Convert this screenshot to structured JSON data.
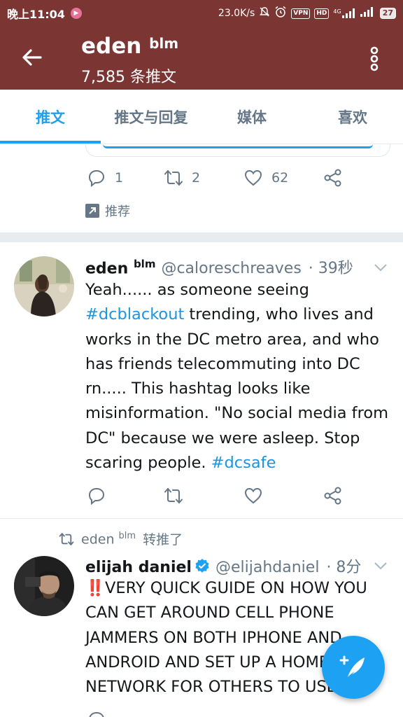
{
  "status_bar": {
    "time": "晚上11:04",
    "speed": "23.0K/s",
    "vpn": "VPN",
    "hd": "HD",
    "network": "4G",
    "battery": "27"
  },
  "header": {
    "title": "eden",
    "title_sup": "blm",
    "subtitle": "7,585 条推文"
  },
  "tabs": [
    {
      "label": "推文",
      "active": true
    },
    {
      "label": "推文与回复",
      "active": false
    },
    {
      "label": "媒体",
      "active": false
    },
    {
      "label": "喜欢",
      "active": false
    }
  ],
  "tweet0": {
    "reply_count": "1",
    "retweet_count": "2",
    "like_count": "62",
    "promoted_label": "推荐"
  },
  "tweet1": {
    "name": "eden",
    "name_sup": "blm",
    "handle": "@caloreschreaves",
    "time": "· 39秒",
    "text_part1": "Yeah...... as someone seeing ",
    "tag1": "#dcblackout",
    "text_part2": " trending, who lives and works in the DC metro area, and who has friends telecommuting into DC rn..... This hashtag looks like misinformation. \"No social media from DC\" because we were asleep. Stop scaring people. ",
    "tag2": "#dcsafe"
  },
  "tweet2": {
    "retweeter": "eden",
    "retweeter_sup": "blm",
    "retweet_label": "转推了",
    "name": "elijah daniel",
    "handle": "@elijahdaniel",
    "time": "· 8分",
    "text": "‼️VERY QUICK GUIDE ON HOW YOU CAN GET AROUND CELL PHONE JAMMERS ON BOTH IPHONE AND ANDROID AND SET UP A HOME NETWORK FOR OTHERS TO USE"
  },
  "colors": {
    "header_bg": "#7b3532",
    "accent": "#1da1f2",
    "secondary_text": "#657786"
  }
}
